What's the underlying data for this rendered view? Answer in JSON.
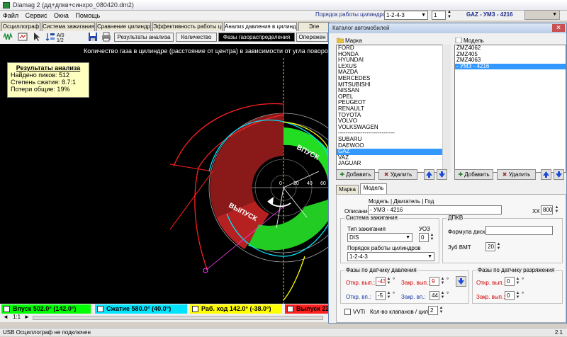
{
  "app": {
    "title": "Diamag 2 (дд+дпкв+синхро_080420.dm2)",
    "menu": [
      "Файл",
      "Сервис",
      "Окна",
      "Помощь"
    ],
    "cyl_order_label": "Порядок работы цилиндров",
    "cyl_order_value": "1-2-4-3",
    "cyl_count_value": "1",
    "vehicle_label": "GAZ - УМЗ - 4216"
  },
  "main_tabs": [
    "Осциллограф",
    "Система зажигания",
    "Сравнение цилиндров",
    "Эффективность работы цилиндров",
    "Анализ давления в цилиндре",
    "Эле"
  ],
  "sub_tabs": [
    "Результаты анализа",
    "Количество",
    "Фазы газораспределения",
    "Опережен"
  ],
  "toolbar_icons": [
    "wave-icon",
    "measure-icon",
    "cursor-icon",
    "sort-icon",
    "save-icon",
    "print-icon"
  ],
  "toolbar_scale_text": "A/0 1/2",
  "plot": {
    "title": "Количество газа в цилиндре (расстояние от центра) в зависимости от угла поворо",
    "intake_label": "ВПУСК",
    "exhaust_label": "ВЫПУСК",
    "axis_ticks": [
      "0",
      "20",
      "40",
      "60"
    ]
  },
  "results": {
    "heading": "Результаты анализа",
    "lines": [
      "Найдено пиков: 512",
      "Степень сжатия: 8.7:1",
      "Потери общие: 19%"
    ]
  },
  "legend": [
    {
      "label": "Впуск 502.0° (142.0°)",
      "color": "#00ff00"
    },
    {
      "label": "Сжатие 580.0° (40.0°)",
      "color": "#00e5ff"
    },
    {
      "label": "Раб. ход 142.0° (-38.0°)",
      "color": "#ffff00"
    },
    {
      "label": "Выпуск 22(",
      "color": "#ff2020"
    }
  ],
  "zoom_label": "1:1",
  "status": {
    "left": "USB Осциллограф не подключен",
    "right": "2.1"
  },
  "dialog": {
    "title": "Каталог автомобилей",
    "brand_header": "Марка",
    "model_header": "Модель",
    "brands": [
      "FORD",
      "HONDA",
      "HYUNDAI",
      "LEXUS",
      "MAZDA",
      "MERCEDES",
      "MITSUBISHI",
      "NISSAN",
      "OPEL",
      "PEUGEOT",
      "RENAULT",
      "TOYOTA",
      "VOLVO",
      "VOLKSWAGEN",
      "------------------------------",
      "SUBARU",
      "DAEWOO",
      "GAZ",
      "VAZ",
      "JAGUAR"
    ],
    "selected_brand": "GAZ",
    "models": [
      "ZMZ4062",
      "ZMZ405",
      "ZMZ4063",
      "- УМЗ - 4216"
    ],
    "selected_model": "- УМЗ - 4216",
    "add_label": "Добавить",
    "delete_label": "Удалить",
    "tabs": [
      "Марка",
      "Модель"
    ],
    "model_columns": "Модель  | Двигатель | Год",
    "description_label": "Описание",
    "description_value": "- УМЗ - 4216",
    "xx_label": "XX",
    "xx_value": "800",
    "ignition_group": "Система зажигания",
    "ignition_type_label": "Тип зажигания",
    "ignition_type_value": "DIS",
    "uoz_label": "УОЗ",
    "uoz_value": "0",
    "order_label": "Порядок работы цилиндров",
    "order_value": "1-2-4-3",
    "dpkv_group": "ДПКВ",
    "formula_label": "Формула диска",
    "formula_value": "",
    "tooth_label": "Зуб ВМТ",
    "tooth_value": "20",
    "pressure_group": "Фазы по датчику давления",
    "open_ex_label": "Откр. вып.:",
    "open_ex_value": "-43",
    "close_ex_label": "Закр. вып.:",
    "close_ex_value": "9",
    "open_in_label": "Откр. вп.:",
    "open_in_value": "-5",
    "close_in_label": "Закр. вп.:",
    "close_in_value": "44",
    "vacuum_group": "Фазы по датчику разряжения",
    "vac_open_ex_value": "0",
    "vac_close_ex_value": "0",
    "vvti_label": "VVTi",
    "valves_label": "Кол-во клапанов / цил.",
    "valves_value": "2",
    "degree": "°"
  }
}
